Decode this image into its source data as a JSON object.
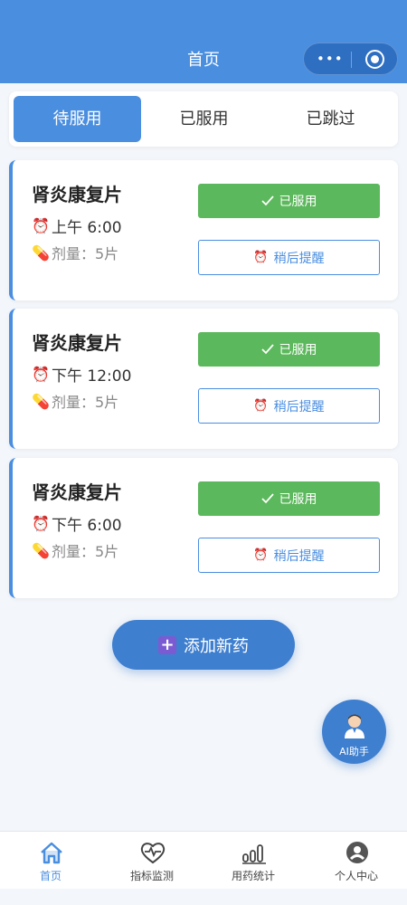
{
  "header": {
    "title": "首页",
    "capsule_more": "•••"
  },
  "tabs": [
    {
      "label": "待服用",
      "active": true
    },
    {
      "label": "已服用",
      "active": false
    },
    {
      "label": "已跳过",
      "active": false
    }
  ],
  "medications": [
    {
      "name": "肾炎康复片",
      "time": "上午 6:00",
      "dose": "剂量：5片",
      "taken_label": "已服用",
      "later_label": "稍后提醒"
    },
    {
      "name": "肾炎康复片",
      "time": "下午 12:00",
      "dose": "剂量：5片",
      "taken_label": "已服用",
      "later_label": "稍后提醒"
    },
    {
      "name": "肾炎康复片",
      "time": "下午 6:00",
      "dose": "剂量：5片",
      "taken_label": "已服用",
      "later_label": "稍后提醒"
    }
  ],
  "add_button": {
    "label": "添加新药",
    "icon": "plus-icon"
  },
  "ai_assistant": {
    "label": "AI助手",
    "icon": "doctor-avatar-icon"
  },
  "bottom_nav": [
    {
      "label": "首页",
      "icon": "home-icon",
      "active": true
    },
    {
      "label": "指标监测",
      "icon": "heart-pulse-icon",
      "active": false
    },
    {
      "label": "用药统计",
      "icon": "bar-chart-icon",
      "active": false
    },
    {
      "label": "个人中心",
      "icon": "user-icon",
      "active": false
    }
  ],
  "colors": {
    "primary": "#4a8ee0",
    "success": "#5cb85c",
    "background": "#f3f6fa"
  }
}
